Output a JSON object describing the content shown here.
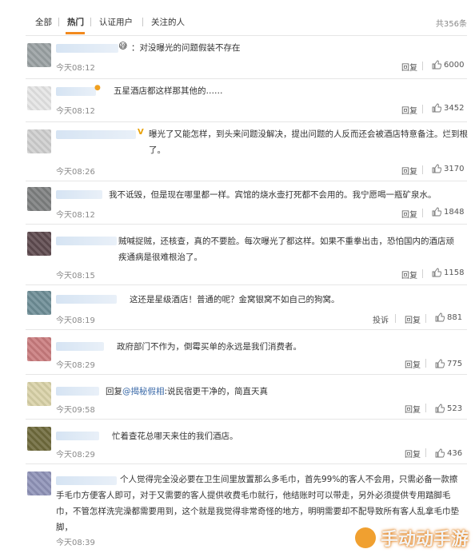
{
  "tabs": [
    "全部",
    "热门",
    "认证用户",
    "关注的人"
  ],
  "total": "共356条",
  "reply_label": "回复",
  "report_label": "投诉",
  "comments": [
    {
      "text": "：对没曝光的问题假装不存在",
      "time": "今天08:12",
      "likes": "6000"
    },
    {
      "text": "五星酒店都这样那其他的……",
      "time": "今天08:12",
      "likes": "3452"
    },
    {
      "text": "曝光了又能怎样，到头来问题没解决，提出问题的人反而还会被酒店特意备注。烂到根了。",
      "time": "今天08:26",
      "likes": "3170"
    },
    {
      "text": "我不诋毁，但是现在哪里都一样。宾馆的烧水壶打死都不会用的。我宁愿喝一瓶矿泉水。",
      "time": "今天08:12",
      "likes": "1848"
    },
    {
      "text": "贼喊捉贼，还核查，真的不要脸。每次曝光了都这样。如果不重拳出击，恐怕国内的酒店顽疾通病是很难根治了。",
      "time": "今天08:15",
      "likes": "1158"
    },
    {
      "text": "这还是星级酒店！普通的呢？金窝银窝不如自己的狗窝。",
      "time": "今天08:19",
      "likes": "881"
    },
    {
      "text": "政府部门不作为，倒霉买单的永远是我们消费者。",
      "time": "今天08:29",
      "likes": "775"
    },
    {
      "reply_prefix": "回复",
      "reply_link": "@揭秘假相",
      "text": ":说民宿更干净的，简直天真",
      "time": "今天09:58",
      "likes": "523"
    },
    {
      "text": "忙着查花总哪天来住的我们酒店。",
      "time": "今天08:29",
      "likes": "436"
    },
    {
      "text": "个人觉得完全没必要在卫生间里放置那么多毛巾，首先99%的客人不会用，只需必备一款擦手毛巾方便客人即可，对于又需要的客人提供收费毛巾就行，他结账时可以带走，另外必须提供专用踏脚毛巾，不管怎样洗完澡都需要用到，这个就是我觉得非常奇怪的地方，明明需要却不配导致所有客人乱拿毛巾垫脚，",
      "time": "今天08:39",
      "likes": ""
    }
  ],
  "watermark": "手动动手游",
  "colors": {
    "accent": "#f28a1e",
    "link": "#3b6aa8"
  }
}
